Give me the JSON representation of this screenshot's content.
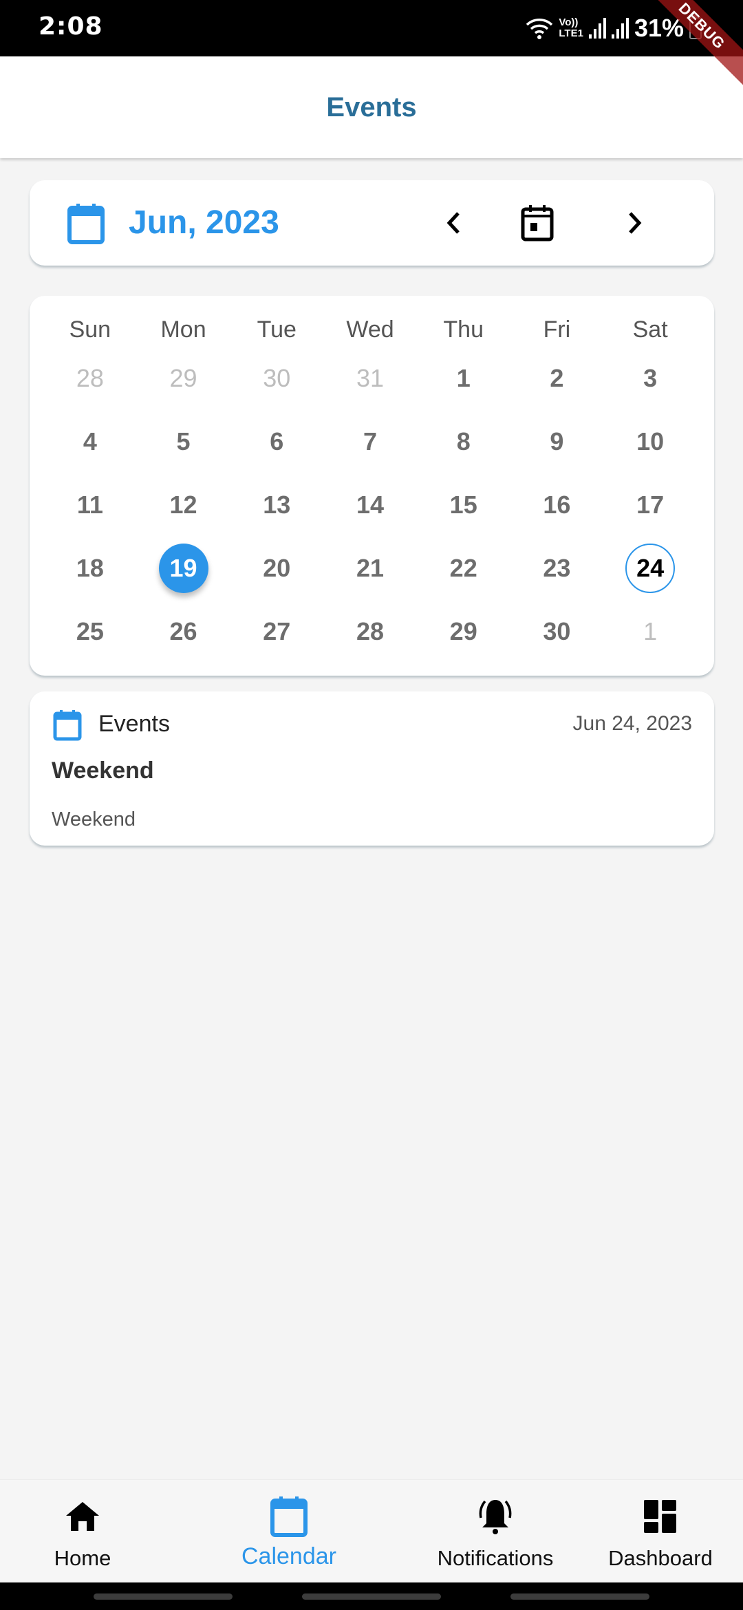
{
  "status_bar": {
    "time": "2:08",
    "network_label_top": "Vo))",
    "network_label_bottom": "LTE1",
    "battery": "31%",
    "icons": [
      "wifi-icon",
      "signal-icon",
      "signal-icon",
      "battery-charging-icon"
    ]
  },
  "debug_banner": "DEBUG",
  "app_bar": {
    "title": "Events"
  },
  "month_header": {
    "label": "Jun, 2023",
    "icon": "calendar-icon",
    "prev_icon": "chevron-left-icon",
    "today_icon": "calendar-today-icon",
    "next_icon": "chevron-right-icon"
  },
  "calendar": {
    "weekdays": [
      "Sun",
      "Mon",
      "Tue",
      "Wed",
      "Thu",
      "Fri",
      "Sat"
    ],
    "weeks": [
      [
        {
          "d": "28",
          "muted": true
        },
        {
          "d": "29",
          "muted": true
        },
        {
          "d": "30",
          "muted": true
        },
        {
          "d": "31",
          "muted": true
        },
        {
          "d": "1"
        },
        {
          "d": "2"
        },
        {
          "d": "3"
        }
      ],
      [
        {
          "d": "4"
        },
        {
          "d": "5"
        },
        {
          "d": "6"
        },
        {
          "d": "7"
        },
        {
          "d": "8"
        },
        {
          "d": "9"
        },
        {
          "d": "10"
        }
      ],
      [
        {
          "d": "11"
        },
        {
          "d": "12"
        },
        {
          "d": "13"
        },
        {
          "d": "14"
        },
        {
          "d": "15"
        },
        {
          "d": "16"
        },
        {
          "d": "17"
        }
      ],
      [
        {
          "d": "18"
        },
        {
          "d": "19",
          "selected": true
        },
        {
          "d": "20"
        },
        {
          "d": "21"
        },
        {
          "d": "22"
        },
        {
          "d": "23"
        },
        {
          "d": "24",
          "event": true
        }
      ],
      [
        {
          "d": "25"
        },
        {
          "d": "26"
        },
        {
          "d": "27"
        },
        {
          "d": "28"
        },
        {
          "d": "29"
        },
        {
          "d": "30"
        },
        {
          "d": "1",
          "muted": true
        }
      ]
    ],
    "selected_date": "19",
    "event_date": "24"
  },
  "event": {
    "category": "Events",
    "date": "Jun 24, 2023",
    "title": "Weekend",
    "description": "Weekend"
  },
  "bottom_nav": {
    "items": [
      {
        "label": "Home",
        "icon": "home-icon",
        "active": false
      },
      {
        "label": "Calendar",
        "icon": "calendar-icon",
        "active": true
      },
      {
        "label": "Notifications",
        "icon": "bell-ringing-icon",
        "active": false
      },
      {
        "label": "Dashboard",
        "icon": "dashboard-icon",
        "active": false
      }
    ]
  },
  "colors": {
    "accent": "#2b95e9",
    "title": "#2a6e98",
    "background": "#f4f4f4"
  }
}
